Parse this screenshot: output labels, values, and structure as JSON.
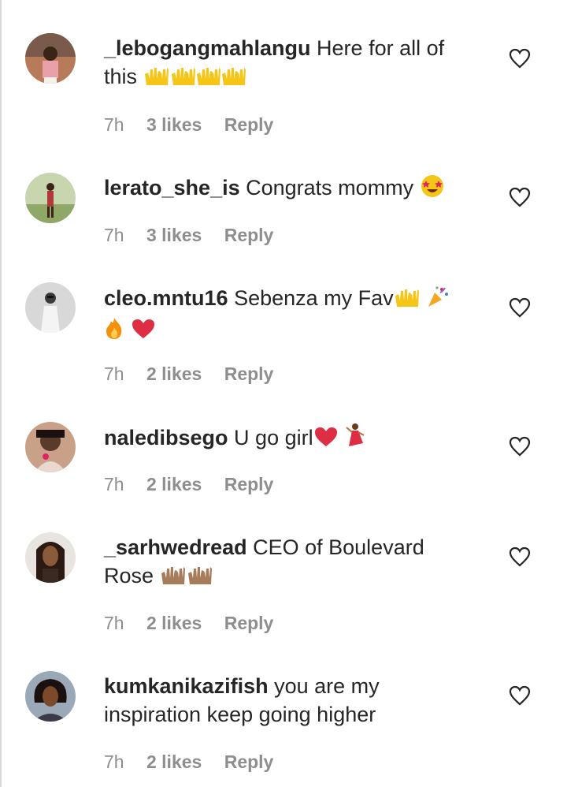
{
  "comments": [
    {
      "username": "_lebogangmahlangu",
      "text": "Here for all of this",
      "emoji": [
        "raising-hands",
        "raising-hands",
        "raising-hands",
        "raising-hands"
      ],
      "time": "7h",
      "likes": "3 likes",
      "reply": "Reply",
      "avatar_color": "#c98a6a"
    },
    {
      "username": "lerato_she_is",
      "text": "Congrats mommy",
      "emoji": [
        "star-struck"
      ],
      "time": "7h",
      "likes": "3 likes",
      "reply": "Reply",
      "avatar_color": "#8aa06a"
    },
    {
      "username": "cleo.mntu16",
      "text": "Sebenza my Fav",
      "emoji": [
        "raising-hands",
        "party-popper",
        "fire",
        "red-heart"
      ],
      "time": "7h",
      "likes": "2 likes",
      "reply": "Reply",
      "avatar_color": "#9a9a9a"
    },
    {
      "username": "naledibsego",
      "text": "U go girl",
      "emoji": [
        "red-heart",
        "dancer"
      ],
      "time": "7h",
      "likes": "2 likes",
      "reply": "Reply",
      "avatar_color": "#6a4a3a"
    },
    {
      "username": "_sarhwedread",
      "text": "CEO of Boulevard Rose",
      "emoji": [
        "raising-hands-dark",
        "raising-hands-dark"
      ],
      "time": "7h",
      "likes": "2 likes",
      "reply": "Reply",
      "avatar_color": "#3a2a22"
    },
    {
      "username": "kumkanikazifish",
      "text": "you are my inspiration keep going higher",
      "emoji": [],
      "time": "7h",
      "likes": "2 likes",
      "reply": "Reply",
      "avatar_color": "#4a3a30"
    }
  ],
  "icons": {
    "like": "heart-outline-icon"
  },
  "colors": {
    "text": "#262626",
    "meta": "#8e8e8e",
    "heart_emoji": "#e0245e"
  }
}
